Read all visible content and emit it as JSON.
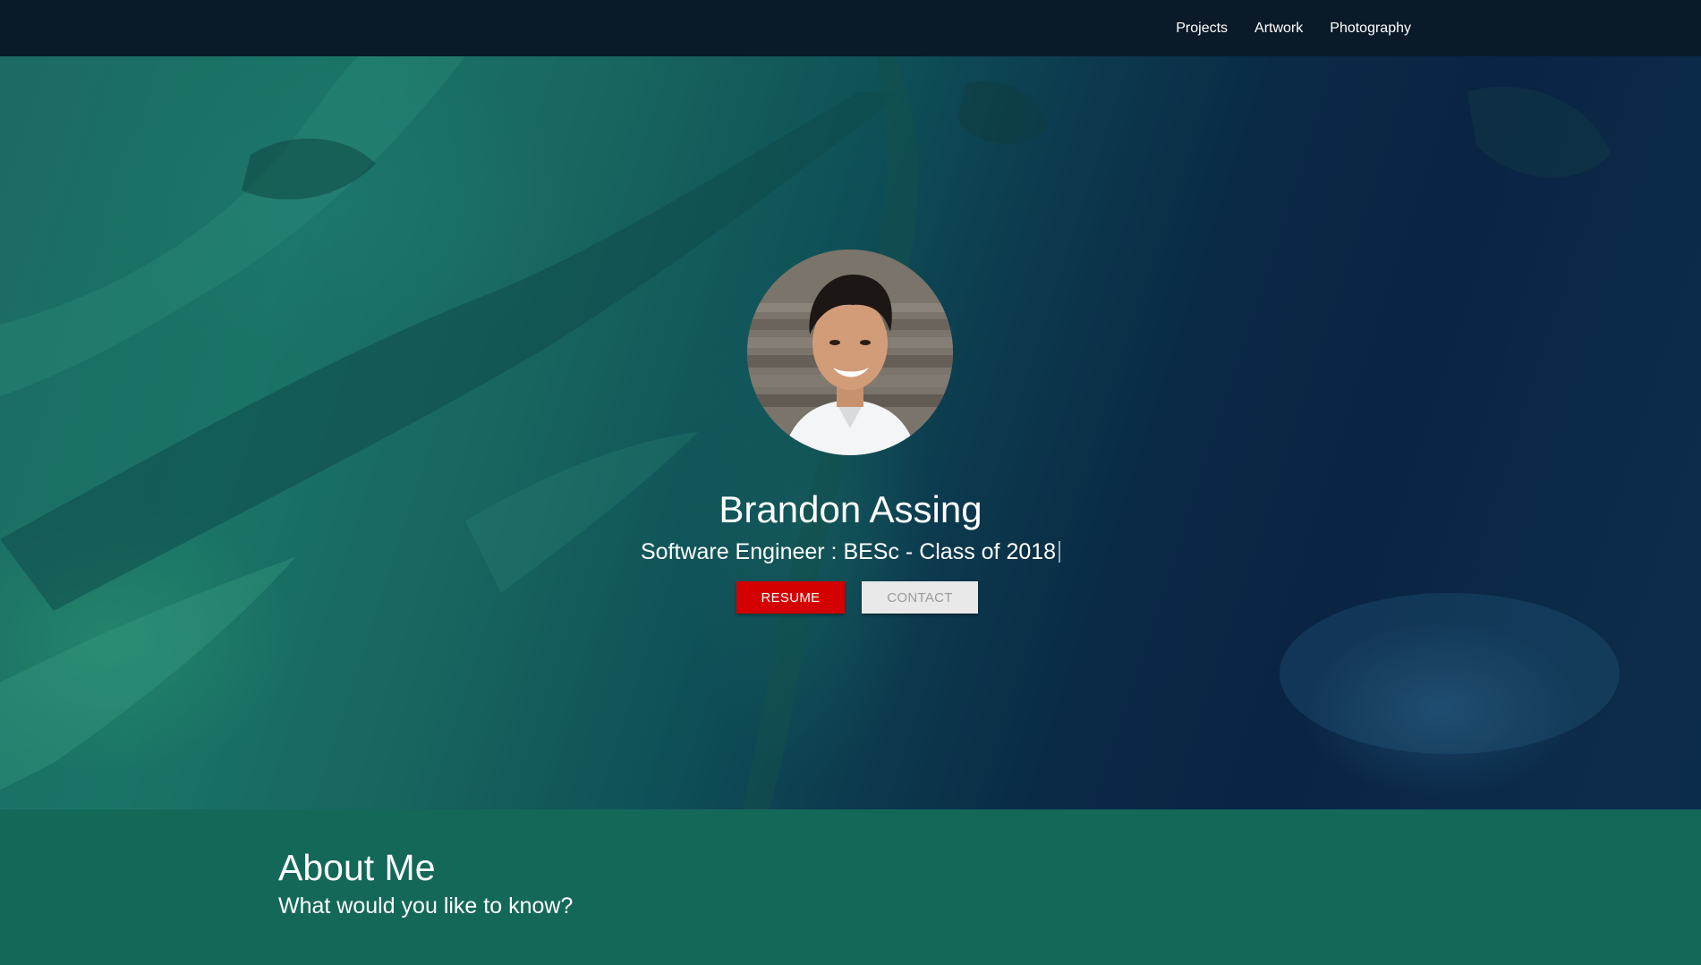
{
  "nav": {
    "links": [
      {
        "label": "Projects"
      },
      {
        "label": "Artwork"
      },
      {
        "label": "Photography"
      }
    ]
  },
  "hero": {
    "name": "Brandon Assing",
    "subtitle": "Software Engineer : BESc - Class of 2018",
    "buttons": {
      "resume": "RESUME",
      "contact": "CONTACT"
    }
  },
  "about": {
    "title": "About Me",
    "subtitle": "What would you like to know?"
  },
  "colors": {
    "navbar": "#0b1a28",
    "resume_button": "#d40000",
    "contact_button": "#e9e9e9",
    "about_background": "#146858"
  }
}
